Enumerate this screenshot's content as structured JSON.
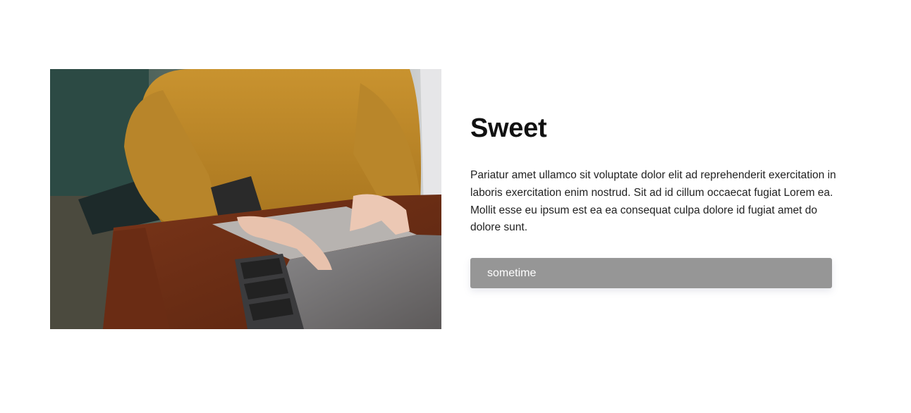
{
  "card": {
    "title": "Sweet",
    "body": "Pariatur amet ullamco sit voluptate dolor elit ad reprehenderit exercitation in laboris exercitation enim nostrud. Sit ad id cillum occaecat fugiat Lorem ea. Mollit esse eu ipsum est ea ea consequat culpa dolore id fugiat amet do dolore sunt.",
    "button_label": "sometime",
    "button_color": "#969696"
  },
  "image": {
    "subject": "person in mustard sweater typing on laptop"
  }
}
